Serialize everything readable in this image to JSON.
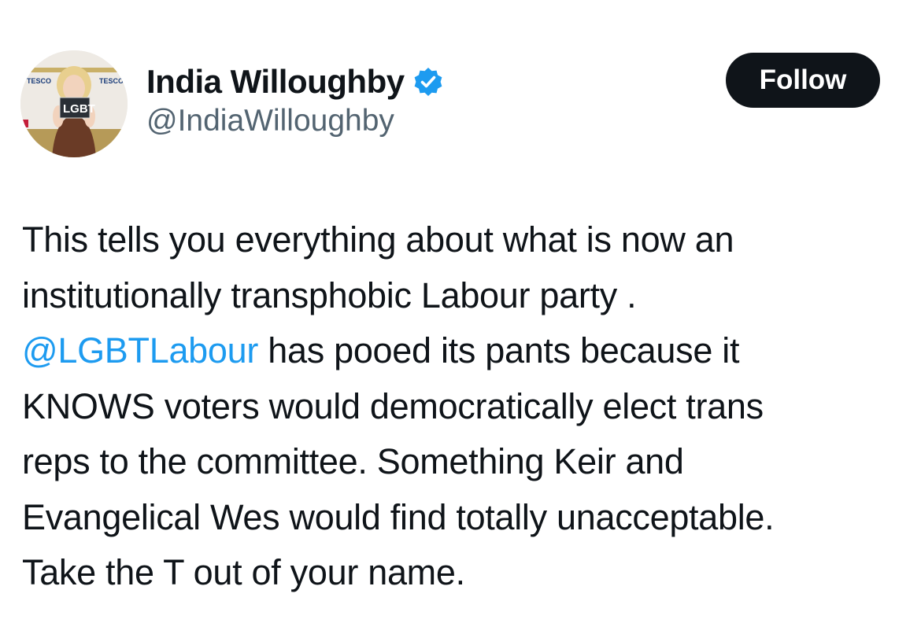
{
  "author": {
    "display_name": "India Willoughby",
    "handle": "@IndiaWilloughby",
    "verified": true,
    "avatar_icon": "profile-photo"
  },
  "follow_label": "Follow",
  "tweet": {
    "lines": [
      {
        "text": "This tells you everything about what is now an"
      },
      {
        "text": "institutionally transphobic Labour party ."
      },
      {
        "mention": "@LGBTLabour",
        "text": " has pooed its pants because it"
      },
      {
        "text": "KNOWS voters would democratically elect trans"
      },
      {
        "text": "reps to the committee. Something  Keir and"
      },
      {
        "text": "Evangelical Wes would find totally unacceptable."
      },
      {
        "text": "Take the T out of your name."
      }
    ]
  },
  "colors": {
    "text": "#0f1419",
    "secondary_text": "#536471",
    "link": "#1d9bf0",
    "verified_badge": "#1d9bf0",
    "follow_bg": "#0f1419",
    "follow_text": "#ffffff"
  }
}
